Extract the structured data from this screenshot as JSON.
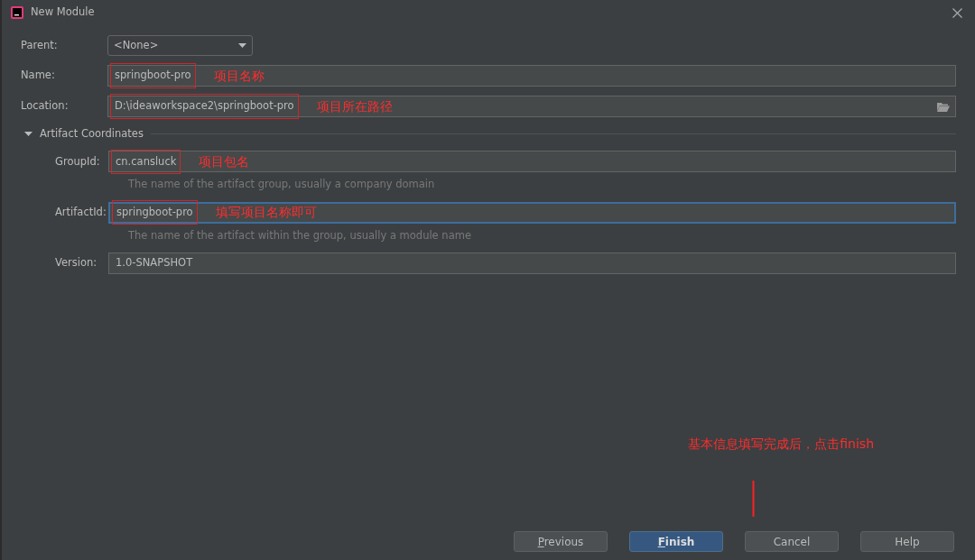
{
  "window": {
    "title": "New Module"
  },
  "parent": {
    "label": "Parent:",
    "value": "<None>"
  },
  "fields": [
    {
      "label": "Name:",
      "value": "springboot-pro",
      "highlighted": true,
      "note": "项目名称",
      "focused": false,
      "browse": false
    },
    {
      "label": "Location:",
      "value": "D:\\ideaworkspace2\\springboot-pro",
      "highlighted": true,
      "note": "项目所在路径",
      "focused": false,
      "browse": true
    }
  ],
  "section": {
    "title": "Artifact Coordinates",
    "expanded": true,
    "fields": [
      {
        "label": "GroupId:",
        "value": "cn.cansluck",
        "highlighted": true,
        "note": "项目包名",
        "focused": false,
        "hint": "The name of the artifact group, usually a company domain"
      },
      {
        "label": "ArtifactId:",
        "value": "springboot-pro",
        "highlighted": true,
        "note": "填写项目名称即可",
        "focused": true,
        "hint": "The name of the artifact within the group, usually a module name"
      },
      {
        "label": "Version:",
        "value": "1.0-SNAPSHOT",
        "highlighted": false,
        "focused": false
      }
    ]
  },
  "annotation": "基本信息填写完成后，点击finish",
  "buttons": [
    {
      "label": "Previous",
      "mnemonic": true,
      "default": false
    },
    {
      "label": "Finish",
      "mnemonic": true,
      "default": true
    },
    {
      "label": "Cancel",
      "mnemonic": false,
      "default": false
    },
    {
      "label": "Help",
      "mnemonic": false,
      "default": false
    }
  ]
}
